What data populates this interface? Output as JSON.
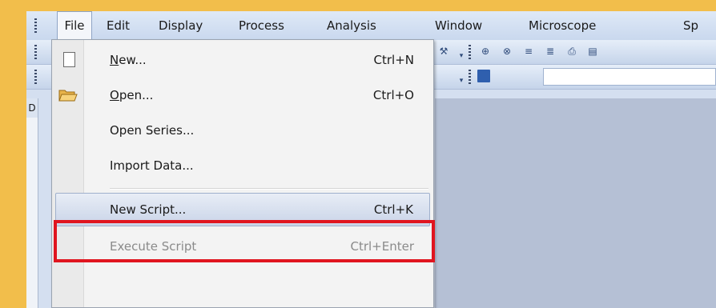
{
  "menubar": {
    "items": [
      "File",
      "Edit",
      "Display",
      "Process",
      "Analysis",
      "Window",
      "Microscope",
      "Sp"
    ]
  },
  "left_panel": {
    "tab_label": "D"
  },
  "file_menu": {
    "items": [
      {
        "label": "New...",
        "mnemonic": "N",
        "shortcut": "Ctrl+N",
        "icon": "new-document-icon",
        "state": "normal"
      },
      {
        "label": "Open...",
        "mnemonic": "O",
        "shortcut": "Ctrl+O",
        "icon": "open-folder-icon",
        "state": "normal"
      },
      {
        "label": "Open Series...",
        "shortcut": "",
        "state": "normal"
      },
      {
        "label": "Import Data...",
        "shortcut": "",
        "state": "normal"
      },
      {
        "label": "New Script...",
        "shortcut": "Ctrl+K",
        "state": "hover"
      },
      {
        "label": "Execute Script",
        "shortcut": "Ctrl+Enter",
        "state": "disabled"
      }
    ]
  },
  "toolbar": {
    "icons": [
      "tools-icon",
      "add-10-icon",
      "remove-10-icon",
      "add-list-icon",
      "remove-list-icon",
      "print-preview-icon",
      "save-icon"
    ]
  },
  "colors": {
    "background": "#f2be4b",
    "highlight_box": "#e0151f",
    "workspace": "#b5c0d5"
  }
}
